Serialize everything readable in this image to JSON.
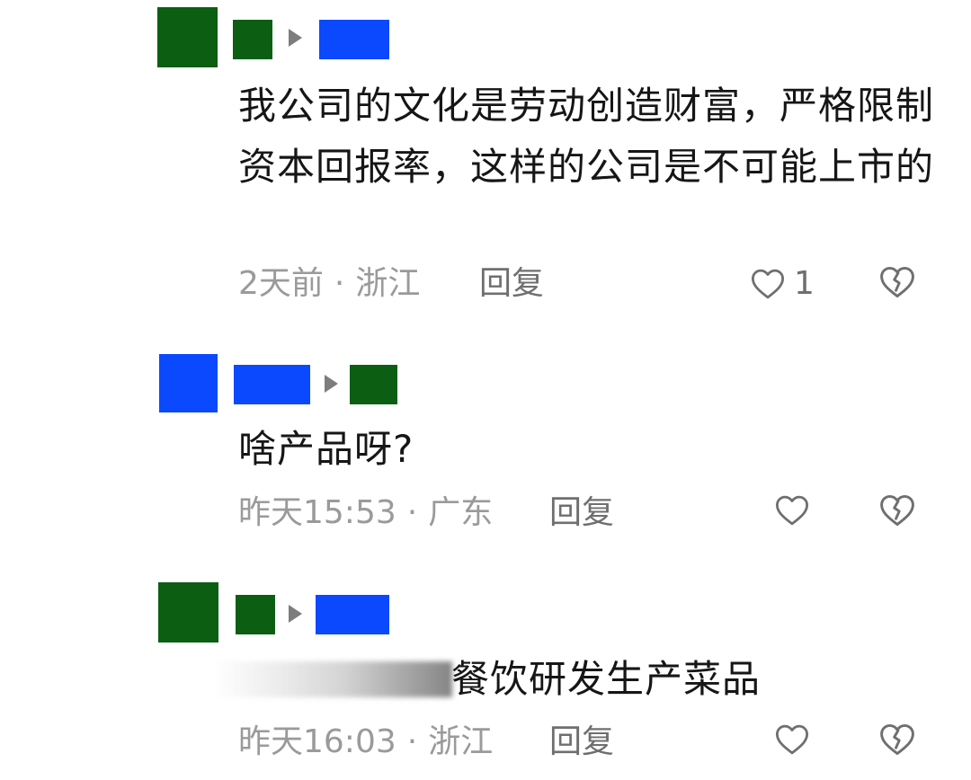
{
  "colors": {
    "avatar_green": "#0b5e12",
    "avatar_blue": "#0a49ff",
    "name_green": "#0b5e12",
    "name_blue": "#0a49ff",
    "meta_gray": "#9a9a9a",
    "action_gray": "#6f6f6f",
    "text": "#161616"
  },
  "comments": [
    {
      "author_color": "avatar_green",
      "reply_to_color": "name_blue",
      "text": "我公司的文化是劳动创造财富，严格限制资本回报率，这样的公司是不可能上市的",
      "time": "2天前",
      "location": "浙江",
      "reply_label": "回复",
      "like_count": "1",
      "like_icon": "heart-icon",
      "dislike_icon": "broken-heart-icon"
    },
    {
      "author_color": "avatar_blue",
      "reply_to_color": "name_green",
      "text": "啥产品呀?",
      "time": "昨天15:53",
      "location": "广东",
      "reply_label": "回复",
      "like_count": "",
      "like_icon": "heart-icon",
      "dislike_icon": "broken-heart-icon"
    },
    {
      "author_color": "avatar_green",
      "reply_to_color": "name_blue",
      "text": "餐饮研发生产菜品",
      "time": "昨天16:03",
      "location": "浙江",
      "reply_label": "回复",
      "like_count": "",
      "like_icon": "heart-icon",
      "dislike_icon": "broken-heart-icon"
    }
  ]
}
